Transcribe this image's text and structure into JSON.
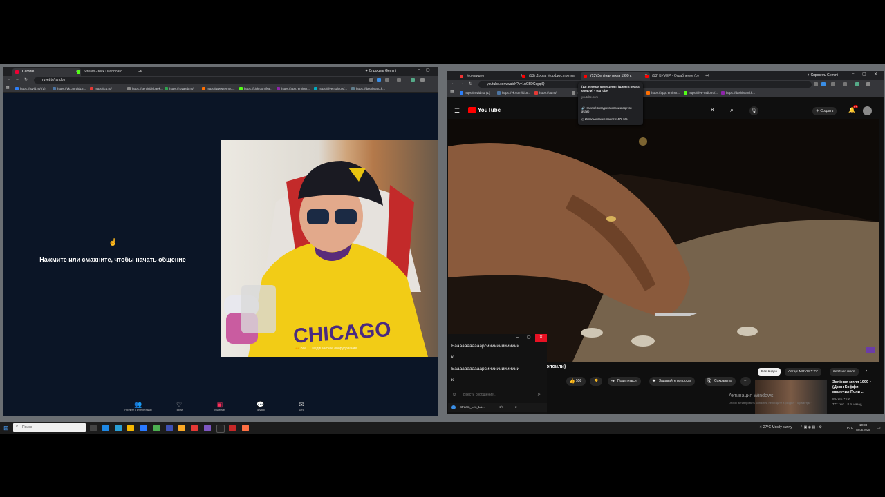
{
  "left_window": {
    "tabs": [
      {
        "label": "Camble",
        "color": "#e03"
      },
      {
        "label": "Stream - Kick Dashboard",
        "color": "#53fc18"
      }
    ],
    "gemini_label": "Спросить Gemini",
    "url": "ruvet.tv/random",
    "bookmarks": [
      "https://ruvid.ru/ (1)",
      "https://vk.com/id18...",
      "https://cu.ru/",
      "https://sercinbisbaek...",
      "https://ruvaleb.ru/",
      "https://www.temuu...",
      "https://kick.com/ka...",
      "https://app.reminer...",
      "https://live.ru/louis/...",
      "https://dashboard.k..."
    ],
    "prompt": "Нажмите или смахните, чтобы начать общение",
    "cam_caption": "Все",
    "cam_caption2": "медицинское оборудование",
    "bottom_nav": [
      {
        "label": "Начните с интересными",
        "icon": "people-icon",
        "active": false
      },
      {
        "label": "Пойти",
        "icon": "heart-icon",
        "active": false
      },
      {
        "label": "Видеочат",
        "icon": "video-icon",
        "active": true
      },
      {
        "label": "Друзья",
        "icon": "chat-icon",
        "active": false
      },
      {
        "label": "Чаты",
        "icon": "message-icon",
        "active": false
      }
    ]
  },
  "right_window": {
    "tabs": [
      {
        "label": "Мои видео",
        "color": "#e33"
      },
      {
        "label": "(13) Доска. Морфиус против",
        "color": "#f00"
      },
      {
        "label": "(13) Зелёная миля 1999 г.",
        "color": "#f00"
      },
      {
        "label": "(13) БУМЕР - Ограбление (ру",
        "color": "#f00"
      }
    ],
    "gemini_label": "Спросить Gemini",
    "url": "youtube.com/watch?v=1uC5DCcgqiQ",
    "bookmarks": [
      "https://ruvid.ru/ (1)",
      "https://vk.com/id18...",
      "https://cu.ru/",
      "https://www.temuu...",
      "https://kick.com/ka...",
      "https://app.reminer...",
      "https://live-radio.ru/...",
      "https://dashboard.k..."
    ],
    "youtube": {
      "logo": "YouTube",
      "create_label": "Создать",
      "notif_count": "9+",
      "title_fragment": "опоили)",
      "likes": "558",
      "share": "Поделиться",
      "ask": "Задавайте вопросы",
      "save": "Сохранить",
      "chips": [
        "Все видео",
        "Автор: MOVIE ⌗ TV",
        "Зелёная миля"
      ],
      "rec_title": "Зелёная миля 1999 г (Джон Коффи вылечил Поли ...",
      "rec_channel": "MOVIE ⌗ TV",
      "rec_meta": "777 тыс. · 8 л. назад",
      "watermark": "Активация Windows",
      "watermark_sub": "Чтобы активировать Windows, перейдите в раздел \"Параметры\"."
    },
    "tooltip": {
      "title": "(13) Зелёная миля 1999 г. (Джонга Белла опоили) - YouTube",
      "domain": "youtube.com",
      "line1": "На этой вкладке воспроизводится аудио",
      "line2": "Использование памяти: 473 МБ"
    }
  },
  "chat": {
    "messages": [
      "Бааааааааааарсиииииииииииии",
      "к",
      "Бааааааааааарсиииииииииииии",
      "к"
    ],
    "placeholder": "Ввести сообщение...",
    "footer_name": "Stream_Leo_La...",
    "footer_stats1": "1/1",
    "footer_stats2": "2"
  },
  "taskbar": {
    "search_placeholder": "Поиск",
    "weather": "27°C  Mostly sunny",
    "lang": "РУС",
    "time": "10:38",
    "date": "08.06.2025"
  }
}
